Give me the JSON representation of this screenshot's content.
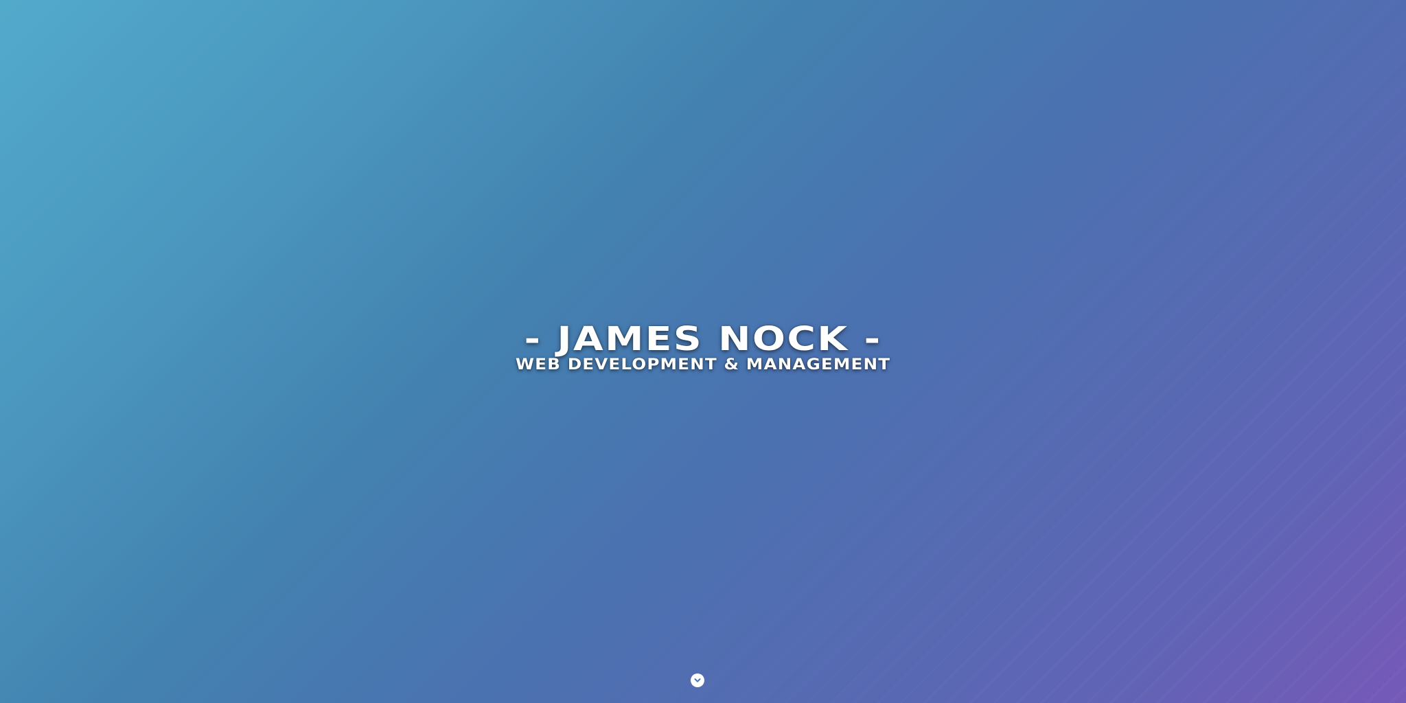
{
  "hero": {
    "title": "- James Nock -",
    "subtitle": "Web Development & Management"
  },
  "scroll": {
    "icon": "chevron-down-icon"
  },
  "colors": {
    "gradient_start": "#52aacb",
    "gradient_mid": "#4382b0",
    "gradient_end": "#7659b8",
    "text": "#ffffff"
  }
}
